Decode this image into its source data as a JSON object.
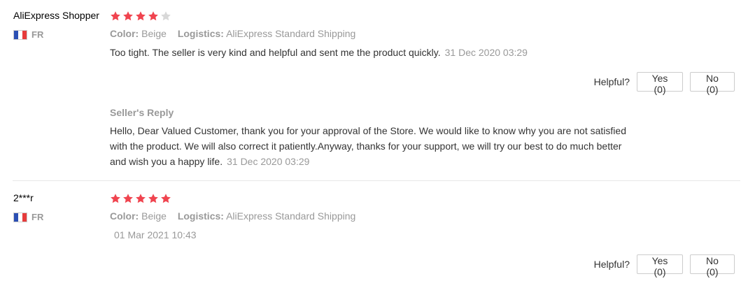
{
  "reviews": [
    {
      "user": "AliExpress Shopper",
      "country": "FR",
      "rating": 4,
      "color_key": "Color:",
      "color_value": "Beige",
      "logistics_key": "Logistics:",
      "logistics_value": "AliExpress Standard Shipping",
      "text": "Too tight. The seller is very kind and helpful and sent me the product quickly.",
      "date": "31 Dec 2020 03:29",
      "helpful_label": "Helpful?",
      "yes_label": "Yes (0)",
      "no_label": "No (0)",
      "reply": {
        "title": "Seller's Reply",
        "text": "Hello, Dear Valued Customer, thank you for your approval of the Store. We would like to know why you are not satisfied with the product. We will also correct it patiently.Anyway, thanks for your support, we will try our best to do much better and wish you a happy life.",
        "date": "31 Dec 2020 03:29"
      }
    },
    {
      "user": "2***r",
      "country": "FR",
      "rating": 5,
      "color_key": "Color:",
      "color_value": "Beige",
      "logistics_key": "Logistics:",
      "logistics_value": "AliExpress Standard Shipping",
      "text": "",
      "date": "01 Mar 2021 10:43",
      "helpful_label": "Helpful?",
      "yes_label": "Yes (0)",
      "no_label": "No (0)"
    }
  ],
  "colors": {
    "star_filled": "#f0444f",
    "star_empty": "#d8d8d8",
    "muted_text": "#999999",
    "body_text": "#333333"
  },
  "icons": {
    "star": "star-icon",
    "flag": "france-flag-icon"
  }
}
